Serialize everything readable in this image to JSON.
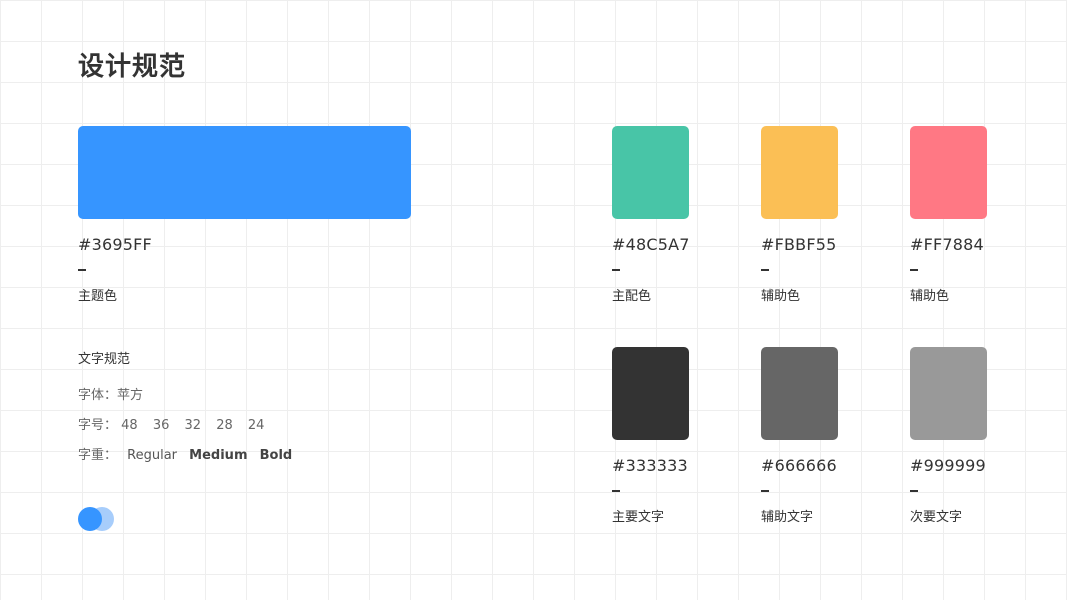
{
  "page": {
    "title": "设计规范"
  },
  "colors": {
    "primary": {
      "hex": "#3695FF",
      "label": "主题色",
      "swatch": "#3695ff"
    },
    "accent": [
      {
        "hex": "#48C5A7",
        "label": "主配色",
        "swatch": "#48c5a7"
      },
      {
        "hex": "#FBBF55",
        "label": "辅助色",
        "swatch": "#fbbf55"
      },
      {
        "hex": "#FF7884",
        "label": "辅助色",
        "swatch": "#ff7884"
      }
    ],
    "text": [
      {
        "hex": "#333333",
        "label": "主要文字",
        "swatch": "#333333"
      },
      {
        "hex": "#666666",
        "label": "辅助文字",
        "swatch": "#666666"
      },
      {
        "hex": "#999999",
        "label": "次要文字",
        "swatch": "#999999"
      }
    ]
  },
  "typography": {
    "title": "文字规范",
    "font": {
      "label": "字体：",
      "value": "苹方"
    },
    "size": {
      "label": "字号：",
      "values": [
        "48",
        "36",
        "32",
        "28",
        "24"
      ]
    },
    "weight": {
      "label": "字重：",
      "values": [
        "Regular",
        "Medium",
        "Bold"
      ]
    }
  },
  "toggle": {
    "colors": [
      "#3695ff",
      "#a7cdfb"
    ]
  }
}
